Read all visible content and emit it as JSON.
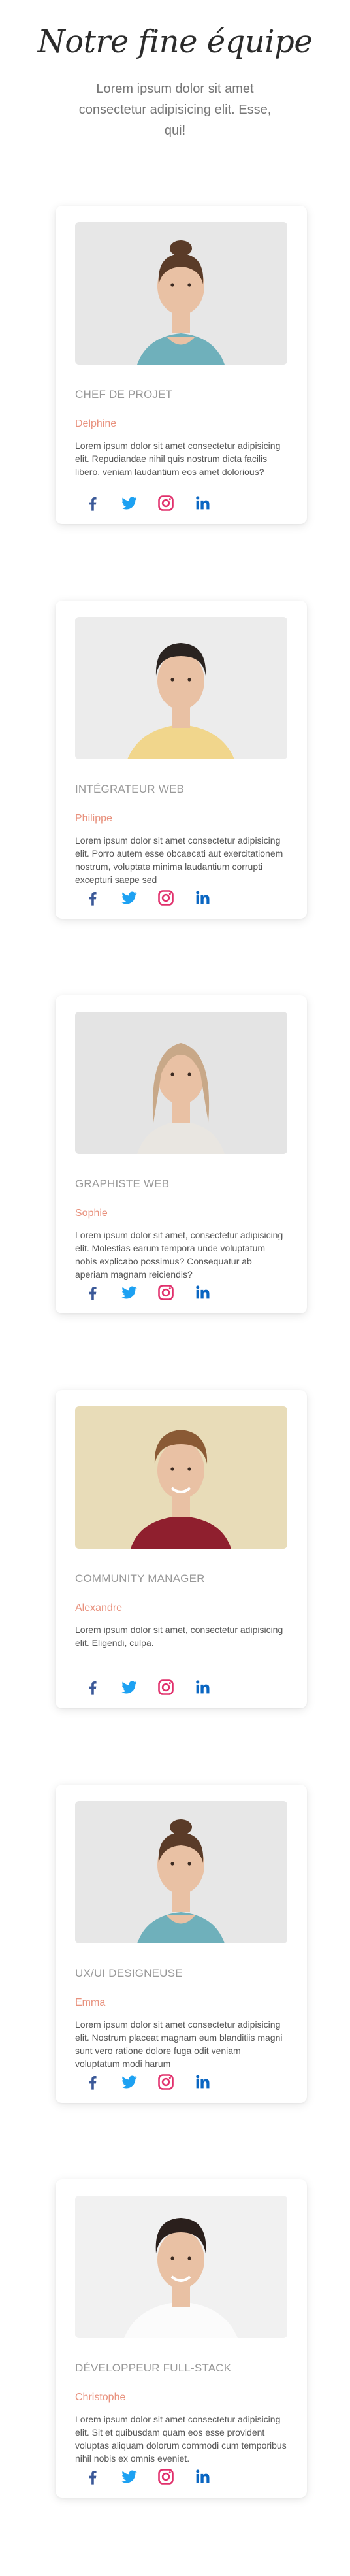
{
  "header": {
    "title": "Notre fine équipe",
    "subtitle": "Lorem ipsum dolor sit amet consectetur adipisicing elit. Esse, qui!"
  },
  "colors": {
    "accent": "#e8917d",
    "facebook": "#3b5998",
    "twitter": "#1da1f2",
    "instagram": "#e1306c",
    "linkedin": "#0a66c2"
  },
  "members": [
    {
      "role": "CHEF DE PROJET",
      "name": "Delphine",
      "desc": "Lorem ipsum dolor sit amet consectetur adipisicing elit. Repudiandae nihil quis nostrum dicta facilis libero, veniam laudantium eos amet dolorious?",
      "photo": "woman-bun-icon"
    },
    {
      "role": "INTÉGRATEUR WEB",
      "name": "Philippe",
      "desc": "Lorem ipsum dolor sit amet consectetur adipisicing elit. Porro autem esse obcaecati aut exercitationem nostrum, voluptate minima laudantium corrupti excepturi saepe sed",
      "photo": "man-dark-hair-icon"
    },
    {
      "role": "GRAPHISTE WEB",
      "name": "Sophie",
      "desc": "Lorem ipsum dolor sit amet, consectetur adipisicing elit. Molestias earum tempora unde voluptatum nobis explicabo possimus? Consequatur ab aperiam magnam reiciendis?",
      "photo": "woman-long-hair-icon"
    },
    {
      "role": "COMMUNITY MANAGER",
      "name": "Alexandre",
      "desc": "Lorem ipsum dolor sit amet, consectetur adipisicing elit. Eligendi, culpa.",
      "photo": "man-smiling-icon"
    },
    {
      "role": "UX/UI DESIGNEUSE",
      "name": "Emma",
      "desc": "Lorem ipsum dolor sit amet consectetur adipisicing elit. Nostrum placeat magnam eum blanditiis magni sunt vero ratione dolore fuga odit veniam voluptatum modi harum",
      "photo": "woman-bun-icon"
    },
    {
      "role": "DÉVELOPPEUR FULL-STACK",
      "name": "Christophe",
      "desc": "Lorem ipsum dolor sit amet consectetur adipisicing elit. Sit et quibusdam quam eos esse provident voluptas aliquam dolorum commodi cum temporibus nihil nobis ex omnis eveniet.",
      "photo": "man-white-tshirt-icon"
    }
  ],
  "socials": [
    "facebook-icon",
    "twitter-icon",
    "instagram-icon",
    "linkedin-icon"
  ]
}
